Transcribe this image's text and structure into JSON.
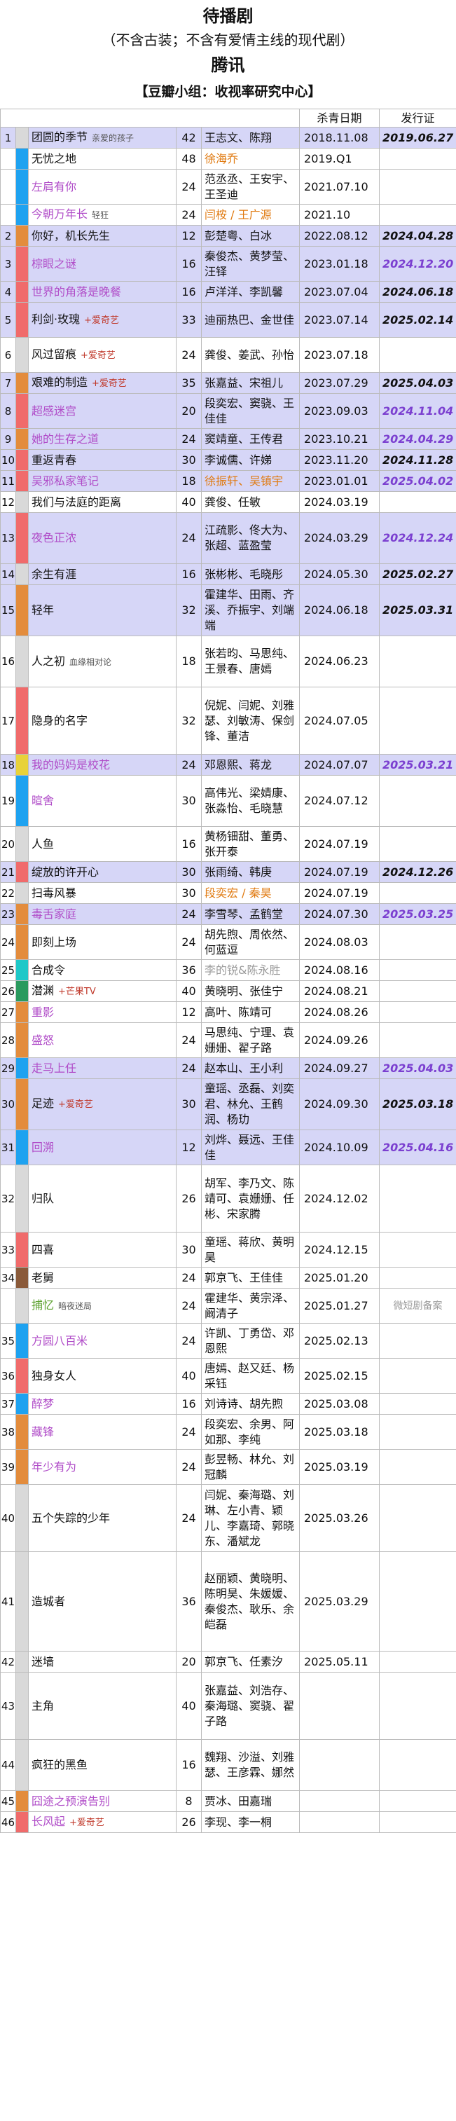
{
  "header": {
    "title": "待播剧",
    "subtitle": "（不含古装；不含有爱情主线的现代剧）",
    "platform": "腾讯",
    "group": "【豆瓣小组：收视率研究中心】"
  },
  "columns": {
    "kill": "杀青日期",
    "license": "发行证"
  },
  "colors": {
    "highlight": "#d6d6f7",
    "purple_text": "#b04cc8",
    "green_text": "#5aa02c",
    "orange_text": "#e07a10",
    "network_note": "#c0392b"
  },
  "rows": [
    {
      "no": "1",
      "bar": "#d9d9d9",
      "title": "团圆的季节",
      "tc": "",
      "note": "亲爱的孩子",
      "nc": "note",
      "ep": "42",
      "cast": "王志文、陈翔",
      "cc": "",
      "kill": "2018.11.08",
      "lic": "2019.06.27",
      "lc": "",
      "hl": true
    },
    {
      "no": "",
      "bar": "#1ea2f0",
      "title": "无忧之地",
      "tc": "",
      "note": "",
      "nc": "",
      "ep": "48",
      "cast": "徐海乔",
      "cc": "ora",
      "kill": "2019.Q1",
      "lic": "",
      "lc": "",
      "hl": false
    },
    {
      "no": "",
      "bar": "#1ea2f0",
      "title": "左肩有你",
      "tc": "pur",
      "note": "",
      "nc": "",
      "ep": "24",
      "cast": "范丞丞、王安宇、王圣迪",
      "cc": "",
      "kill": "2021.07.10",
      "lic": "",
      "lc": "",
      "hl": false
    },
    {
      "no": "",
      "bar": "#1ea2f0",
      "title": "今朝万年长",
      "tc": "pur",
      "note": "轻狂",
      "nc": "note",
      "ep": "24",
      "cast": "闫桉 / 王广源",
      "cc": "ora",
      "kill": "2021.10",
      "lic": "",
      "lc": "",
      "hl": false
    },
    {
      "no": "2",
      "bar": "#e38c3c",
      "title": "你好，机长先生",
      "tc": "",
      "note": "",
      "nc": "",
      "ep": "12",
      "cast": "彭楚粤、白冰",
      "cc": "",
      "kill": "2022.08.12",
      "lic": "2024.04.28",
      "lc": "",
      "hl": true
    },
    {
      "no": "3",
      "bar": "#f06b6b",
      "title": "棕眼之谜",
      "tc": "pur",
      "note": "",
      "nc": "",
      "ep": "16",
      "cast": "秦俊杰、黄梦莹、汪铎",
      "cc": "",
      "kill": "2023.01.18",
      "lic": "2024.12.20",
      "lc": "pup",
      "hl": true
    },
    {
      "no": "4",
      "bar": "#f06b6b",
      "title": "世界的角落是晚餐",
      "tc": "pur",
      "note": "",
      "nc": "",
      "ep": "16",
      "cast": "卢洋洋、李凯馨",
      "cc": "",
      "kill": "2023.07.04",
      "lic": "2024.06.18",
      "lc": "",
      "hl": true
    },
    {
      "no": "5",
      "bar": "#f06b6b",
      "title": "利剑·玫瑰",
      "tc": "",
      "note": "+爱奇艺",
      "nc": "nr",
      "ep": "33",
      "cast": "迪丽热巴、金世佳",
      "cc": "",
      "kill": "2023.07.14",
      "lic": "2025.02.14",
      "lc": "",
      "hl": true
    },
    {
      "no": "6",
      "bar": "#d9d9d9",
      "title": "风过留痕",
      "tc": "",
      "note": "+爱奇艺",
      "nc": "nr",
      "ep": "24",
      "cast": "龚俊、姜武、孙怡",
      "cc": "",
      "kill": "2023.07.18",
      "lic": "",
      "lc": "",
      "hl": false
    },
    {
      "no": "7",
      "bar": "#e38c3c",
      "title": "艰难的制造",
      "tc": "",
      "note": "+爱奇艺",
      "nc": "nr",
      "ep": "35",
      "cast": "张嘉益、宋祖儿",
      "cc": "",
      "kill": "2023.07.29",
      "lic": "2025.04.03",
      "lc": "",
      "hl": true
    },
    {
      "no": "8",
      "bar": "#f06b6b",
      "title": "超感迷宫",
      "tc": "pur",
      "note": "",
      "nc": "",
      "ep": "20",
      "cast": "段奕宏、窦骁、王佳佳",
      "cc": "",
      "kill": "2023.09.03",
      "lic": "2024.11.04",
      "lc": "pup",
      "hl": true
    },
    {
      "no": "9",
      "bar": "#e38c3c",
      "title": "她的生存之道",
      "tc": "pur",
      "note": "",
      "nc": "",
      "ep": "24",
      "cast": "窦靖童、王传君",
      "cc": "",
      "kill": "2023.10.21",
      "lic": "2024.04.29",
      "lc": "pup",
      "hl": true
    },
    {
      "no": "10",
      "bar": "#f06b6b",
      "title": "重返青春",
      "tc": "",
      "note": "",
      "nc": "",
      "ep": "30",
      "cast": "李诚儒、许娣",
      "cc": "",
      "kill": "2023.11.20",
      "lic": "2024.11.28",
      "lc": "",
      "hl": true
    },
    {
      "no": "11",
      "bar": "#f06b6b",
      "title": "吴邪私家笔记",
      "tc": "pur",
      "note": "",
      "nc": "",
      "ep": "18",
      "cast": "徐振轩、吴镇宇",
      "cc": "ora",
      "kill": "2023.01.01",
      "lic": "2025.04.02",
      "lc": "pup",
      "hl": true
    },
    {
      "no": "12",
      "bar": "#d9d9d9",
      "title": "我们与法庭的距离",
      "tc": "",
      "note": "",
      "nc": "",
      "ep": "40",
      "cast": "龚俊、任敏",
      "cc": "",
      "kill": "2024.03.19",
      "lic": "",
      "lc": "",
      "hl": false
    },
    {
      "no": "13",
      "bar": "#f06b6b",
      "title": "夜色正浓",
      "tc": "pur",
      "note": "",
      "nc": "",
      "ep": "24",
      "cast": "江疏影、佟大为、张超、蓝盈莹",
      "cc": "",
      "kill": "2024.03.29",
      "lic": "2024.12.24",
      "lc": "pup",
      "hl": true
    },
    {
      "no": "14",
      "bar": "#d9d9d9",
      "title": "余生有涯",
      "tc": "",
      "note": "",
      "nc": "",
      "ep": "16",
      "cast": "张彬彬、毛晓彤",
      "cc": "",
      "kill": "2024.05.30",
      "lic": "2025.02.27",
      "lc": "",
      "hl": true
    },
    {
      "no": "15",
      "bar": "#e38c3c",
      "title": "轻年",
      "tc": "",
      "note": "",
      "nc": "",
      "ep": "32",
      "cast": "霍建华、田雨、齐溪、乔振宇、刘端端",
      "cc": "",
      "kill": "2024.06.18",
      "lic": "2025.03.31",
      "lc": "",
      "hl": true
    },
    {
      "no": "16",
      "bar": "#d9d9d9",
      "title": "人之初",
      "tc": "",
      "note": "血缘相对论",
      "nc": "note",
      "ep": "18",
      "cast": "张若昀、马思纯、王景春、唐嫣",
      "cc": "",
      "kill": "2024.06.23",
      "lic": "",
      "lc": "",
      "hl": false
    },
    {
      "no": "17",
      "bar": "#f06b6b",
      "title": "隐身的名字",
      "tc": "",
      "note": "",
      "nc": "",
      "ep": "32",
      "cast": "倪妮、闫妮、刘雅瑟、刘敏涛、保剑锋、董洁",
      "cc": "",
      "kill": "2024.07.05",
      "lic": "",
      "lc": "",
      "hl": false
    },
    {
      "no": "18",
      "bar": "#e8d23a",
      "title": "我的妈妈是校花",
      "tc": "pur",
      "note": "",
      "nc": "",
      "ep": "24",
      "cast": "邓恩熙、蒋龙",
      "cc": "",
      "kill": "2024.07.07",
      "lic": "2025.03.21",
      "lc": "pup",
      "hl": true
    },
    {
      "no": "19",
      "bar": "#1ea2f0",
      "title": "暄舍",
      "tc": "pur",
      "note": "",
      "nc": "",
      "ep": "30",
      "cast": "高伟光、梁婧康、张淼怡、毛晓慧",
      "cc": "",
      "kill": "2024.07.12",
      "lic": "",
      "lc": "",
      "hl": false
    },
    {
      "no": "20",
      "bar": "#d9d9d9",
      "title": "人鱼",
      "tc": "",
      "note": "",
      "nc": "",
      "ep": "16",
      "cast": "黄杨钿甜、董勇、张开泰",
      "cc": "",
      "kill": "2024.07.19",
      "lic": "",
      "lc": "",
      "hl": false
    },
    {
      "no": "21",
      "bar": "#f06b6b",
      "title": "绽放的许开心",
      "tc": "",
      "note": "",
      "nc": "",
      "ep": "30",
      "cast": "张雨绮、韩庚",
      "cc": "",
      "kill": "2024.07.19",
      "lic": "2024.12.26",
      "lc": "",
      "hl": true
    },
    {
      "no": "22",
      "bar": "#d9d9d9",
      "title": "扫毒风暴",
      "tc": "",
      "note": "",
      "nc": "",
      "ep": "30",
      "cast": "段奕宏 / 秦昊",
      "cc": "ora",
      "kill": "2024.07.19",
      "lic": "",
      "lc": "",
      "hl": false
    },
    {
      "no": "23",
      "bar": "#e38c3c",
      "title": "毒舌家庭",
      "tc": "pur",
      "note": "",
      "nc": "",
      "ep": "24",
      "cast": "李雪琴、孟鹤堂",
      "cc": "",
      "kill": "2024.07.30",
      "lic": "2025.03.25",
      "lc": "pup",
      "hl": true
    },
    {
      "no": "24",
      "bar": "#e38c3c",
      "title": "即刻上场",
      "tc": "",
      "note": "",
      "nc": "",
      "ep": "24",
      "cast": "胡先煦、周依然、何蓝逗",
      "cc": "",
      "kill": "2024.08.03",
      "lic": "",
      "lc": "",
      "hl": false
    },
    {
      "no": "25",
      "bar": "#1ec8c8",
      "title": "合成令",
      "tc": "",
      "note": "",
      "nc": "",
      "ep": "36",
      "cast": "李的锐&陈永胜",
      "cc": "gry",
      "kill": "2024.08.16",
      "lic": "",
      "lc": "",
      "hl": false
    },
    {
      "no": "26",
      "bar": "#2a9a5e",
      "title": "潜渊",
      "tc": "",
      "note": "+芒果TV",
      "nc": "nr",
      "ep": "40",
      "cast": "黄晓明、张佳宁",
      "cc": "",
      "kill": "2024.08.21",
      "lic": "",
      "lc": "",
      "hl": false
    },
    {
      "no": "27",
      "bar": "#e38c3c",
      "title": "重影",
      "tc": "pur",
      "note": "",
      "nc": "",
      "ep": "12",
      "cast": "高叶、陈靖可",
      "cc": "",
      "kill": "2024.08.26",
      "lic": "",
      "lc": "",
      "hl": false
    },
    {
      "no": "28",
      "bar": "#e38c3c",
      "title": "盛怒",
      "tc": "pur",
      "note": "",
      "nc": "",
      "ep": "24",
      "cast": "马思纯、宁理、袁姗姗、翟子路",
      "cc": "",
      "kill": "2024.09.26",
      "lic": "",
      "lc": "",
      "hl": false
    },
    {
      "no": "29",
      "bar": "#1ea2f0",
      "title": "走马上任",
      "tc": "pur",
      "note": "",
      "nc": "",
      "ep": "24",
      "cast": "赵本山、王小利",
      "cc": "",
      "kill": "2024.09.27",
      "lic": "2025.04.03",
      "lc": "pup",
      "hl": true
    },
    {
      "no": "30",
      "bar": "#e38c3c",
      "title": "足迹",
      "tc": "",
      "note": "+爱奇艺",
      "nc": "nr",
      "ep": "30",
      "cast": "童瑶、丞磊、刘奕君、林允、王鹤润、杨玏",
      "cc": "",
      "kill": "2024.09.30",
      "lic": "2025.03.18",
      "lc": "",
      "hl": true
    },
    {
      "no": "31",
      "bar": "#1ea2f0",
      "title": "回溯",
      "tc": "pur",
      "note": "",
      "nc": "",
      "ep": "12",
      "cast": "刘烨、聂远、王佳佳",
      "cc": "",
      "kill": "2024.10.09",
      "lic": "2025.04.16",
      "lc": "pup",
      "hl": true
    },
    {
      "no": "32",
      "bar": "#d9d9d9",
      "title": "归队",
      "tc": "",
      "note": "",
      "nc": "",
      "ep": "26",
      "cast": "胡军、李乃文、陈靖可、袁姗姗、任彬、宋家腾",
      "cc": "",
      "kill": "2024.12.02",
      "lic": "",
      "lc": "",
      "hl": false
    },
    {
      "no": "33",
      "bar": "#f06b6b",
      "title": "四喜",
      "tc": "",
      "note": "",
      "nc": "",
      "ep": "30",
      "cast": "童瑶、蒋欣、黄明昊",
      "cc": "",
      "kill": "2024.12.15",
      "lic": "",
      "lc": "",
      "hl": false
    },
    {
      "no": "34",
      "bar": "#8a5a3a",
      "title": "老舅",
      "tc": "",
      "note": "",
      "nc": "",
      "ep": "24",
      "cast": "郭京飞、王佳佳",
      "cc": "",
      "kill": "2025.01.20",
      "lic": "",
      "lc": "",
      "hl": false
    },
    {
      "no": "",
      "bar": "#d9d9d9",
      "title": "捕忆",
      "tc": "grn",
      "note": "暗夜迷局",
      "nc": "note",
      "ep": "24",
      "cast": "霍建华、黄宗泽、阚清子",
      "cc": "",
      "kill": "2025.01.27",
      "lic": "微短剧备案",
      "lc": "gry",
      "hl": false
    },
    {
      "no": "35",
      "bar": "#1ea2f0",
      "title": "方圆八百米",
      "tc": "pur",
      "note": "",
      "nc": "",
      "ep": "24",
      "cast": "许凯、丁勇岱、邓恩熙",
      "cc": "",
      "kill": "2025.02.13",
      "lic": "",
      "lc": "",
      "hl": false
    },
    {
      "no": "36",
      "bar": "#f06b6b",
      "title": "独身女人",
      "tc": "",
      "note": "",
      "nc": "",
      "ep": "40",
      "cast": "唐嫣、赵又廷、杨采钰",
      "cc": "",
      "kill": "2025.02.15",
      "lic": "",
      "lc": "",
      "hl": false
    },
    {
      "no": "37",
      "bar": "#1ea2f0",
      "title": "醉梦",
      "tc": "pur",
      "note": "",
      "nc": "",
      "ep": "16",
      "cast": "刘诗诗、胡先煦",
      "cc": "",
      "kill": "2025.03.08",
      "lic": "",
      "lc": "",
      "hl": false
    },
    {
      "no": "38",
      "bar": "#e38c3c",
      "title": "藏锋",
      "tc": "pur",
      "note": "",
      "nc": "",
      "ep": "24",
      "cast": "段奕宏、余男、阿如那、李纯",
      "cc": "",
      "kill": "2025.03.18",
      "lic": "",
      "lc": "",
      "hl": false
    },
    {
      "no": "39",
      "bar": "#e38c3c",
      "title": "年少有为",
      "tc": "pur",
      "note": "",
      "nc": "",
      "ep": "24",
      "cast": "彭昱畅、林允、刘冠麟",
      "cc": "",
      "kill": "2025.03.19",
      "lic": "",
      "lc": "",
      "hl": false
    },
    {
      "no": "40",
      "bar": "#d9d9d9",
      "title": "五个失踪的少年",
      "tc": "",
      "note": "",
      "nc": "",
      "ep": "24",
      "cast": "闫妮、秦海璐、刘琳、左小青、颖儿、李嘉琦、郭晓东、潘斌龙",
      "cc": "",
      "kill": "2025.03.26",
      "lic": "",
      "lc": "",
      "hl": false
    },
    {
      "no": "41",
      "bar": "#d9d9d9",
      "title": "造城者",
      "tc": "",
      "note": "",
      "nc": "",
      "ep": "36",
      "cast": "赵丽颖、黄晓明、陈明昊、朱媛媛、秦俊杰、耿乐、余皑磊",
      "cc": "",
      "kill": "2025.03.29",
      "lic": "",
      "lc": "",
      "hl": false
    },
    {
      "no": "42",
      "bar": "#d9d9d9",
      "title": "迷墙",
      "tc": "",
      "note": "",
      "nc": "",
      "ep": "20",
      "cast": "郭京飞、任素汐",
      "cc": "",
      "kill": "2025.05.11",
      "lic": "",
      "lc": "",
      "hl": false
    },
    {
      "no": "43",
      "bar": "#d9d9d9",
      "title": "主角",
      "tc": "",
      "note": "",
      "nc": "",
      "ep": "40",
      "cast": "张嘉益、刘浩存、秦海璐、窦骁、翟子路",
      "cc": "",
      "kill": "",
      "lic": "",
      "lc": "",
      "hl": false
    },
    {
      "no": "44",
      "bar": "#d9d9d9",
      "title": "疯狂的黑鱼",
      "tc": "",
      "note": "",
      "nc": "",
      "ep": "16",
      "cast": "魏翔、沙溢、刘雅瑟、王彦霖、娜然",
      "cc": "",
      "kill": "",
      "lic": "",
      "lc": "",
      "hl": false
    },
    {
      "no": "45",
      "bar": "#e38c3c",
      "title": "囧途之预演告别",
      "tc": "pur",
      "note": "",
      "nc": "",
      "ep": "8",
      "cast": "贾冰、田嘉瑞",
      "cc": "",
      "kill": "",
      "lic": "",
      "lc": "",
      "hl": false
    },
    {
      "no": "46",
      "bar": "#f06b6b",
      "title": "长风起",
      "tc": "pur",
      "note": "+爱奇艺",
      "nc": "nr",
      "ep": "26",
      "cast": "李现、李一桐",
      "cc": "",
      "kill": "",
      "lic": "",
      "lc": "",
      "hl": false
    }
  ]
}
